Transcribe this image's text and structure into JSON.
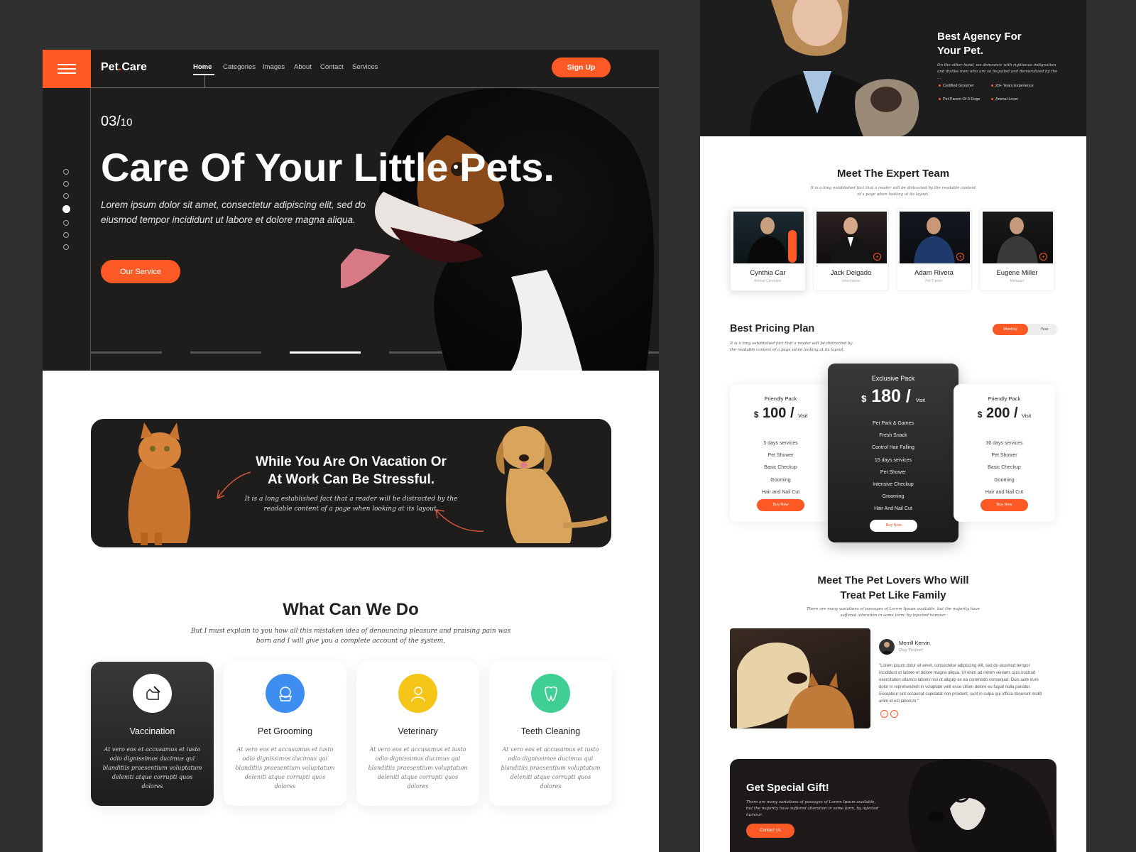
{
  "left": {
    "header": {
      "logo_main": "Pet",
      "logo_dot": ".",
      "logo_end": "Care",
      "nav": [
        "Home",
        "Categories",
        "Images",
        "About",
        "Contact",
        "Services"
      ],
      "signup": "Sign Up"
    },
    "hero": {
      "counter_current": "03/",
      "counter_total": "10",
      "title": "Care Of Your Little Pets.",
      "subtitle": "Lorem ipsum dolor sit amet, consectetur adipiscing elit, sed do eiusmod tempor incididunt ut labore et dolore magna aliqua.",
      "button": "Our Service",
      "active_slide_dot": 4,
      "active_slide_bar": 3
    },
    "vacation": {
      "title_line1": "While You Are On Vacation Or",
      "title_line2": "At Work Can Be Stressful.",
      "subtitle": "It is a long established fact that a reader will be distracted by the readable content of a page when looking at its layout."
    },
    "services": {
      "title": "What Can We Do",
      "subtitle": "But I must explain to you how all this mistaken idea of denouncing pleasure and praising pain was born and I will give you a complete account of the system,",
      "items": [
        {
          "name": "Vaccination",
          "desc": "At vero eos et accusamus et iusto odio dignissimos ducimus qui blanditiis praesentium voluptatum deleniti atque corrupti quos dolores",
          "icon": "vaccination-icon",
          "color": "#ffffff"
        },
        {
          "name": "Pet Grooming",
          "desc": "At vero eos et accusamus et iusto odio dignissimos ducimus qui blanditiis praesentium voluptatum deleniti atque corrupti quos dolores",
          "icon": "grooming-icon",
          "color": "#3d8ef0"
        },
        {
          "name": "Veterinary",
          "desc": "At vero eos et accusamus et iusto odio dignissimos ducimus qui blanditiis praesentium voluptatum deleniti atque corrupti quos dolores",
          "icon": "veterinary-icon",
          "color": "#f5c518"
        },
        {
          "name": "Teeth Cleaning",
          "desc": "At vero eos et accusamus et iusto odio dignissimos ducimus qui blanditiis praesentium voluptatum deleniti atque corrupti quos dolores",
          "icon": "teeth-icon",
          "color": "#3fcf95"
        }
      ]
    }
  },
  "right": {
    "agency": {
      "title_line1": "Best Agency For",
      "title_line2": "Your Pet.",
      "subtitle": "On the other hand, we denounce with righteous indignation and dislike men who are so beguiled and demoralized by the ...",
      "features": [
        "Certified Groomer",
        "20+ Years Experience",
        "Pet Parent Of 3 Dogs",
        "Animal Lover"
      ]
    },
    "team": {
      "title": "Meet The Expert Team",
      "subtitle": "It is a long established fact that a reader will be distracted by the readable content of a page when looking at its layout.",
      "members": [
        {
          "name": "Cynthia Car",
          "role": "Animal Caretaker"
        },
        {
          "name": "Jack Delgado",
          "role": "Veterinarian"
        },
        {
          "name": "Adam Rivera",
          "role": "Pet Trainer"
        },
        {
          "name": "Eugene Miller",
          "role": "Manager"
        }
      ]
    },
    "pricing": {
      "title": "Best Pricing Plan",
      "subtitle": "It is a long established fact that a reader will be distracted by the readable content of a page when looking at its layout.",
      "toggle_monthly": "Monthly",
      "toggle_year": "Year",
      "currency": "$",
      "per": "Visit",
      "slash": "/",
      "plans": [
        {
          "name": "Friendly Pack",
          "price": "100",
          "features": [
            "5 days services",
            "Pet Shower",
            "Basic Checkup",
            "Gooming",
            "Hair and Nail Cut"
          ],
          "button": "Buy Now"
        },
        {
          "name": "Exclusive Pack",
          "price": "180",
          "features": [
            "Pet Park & Games",
            "Fresh Snack",
            "Control Hair Falling",
            "15 days services",
            "Pet Shower",
            "Intensive Checkup",
            "Grooming",
            "Hair And Nail Cut"
          ],
          "button": "Buy Now"
        },
        {
          "name": "Friendly Pack",
          "price": "200",
          "features": [
            "30 days services",
            "Pet Shower",
            "Basic Checkup",
            "Gooming",
            "Hair and Nail Cut"
          ],
          "button": "Buy Now"
        }
      ]
    },
    "lovers": {
      "title_line1": "Meet The Pet Lovers Who Will",
      "title_line2": "Treat Pet Like Family",
      "subtitle": "There are many variations of passages of Lorem Ipsum available, but the majority have suffered alteration in some form, by injected humour.",
      "name": "Merrill Kervin",
      "role": "Dog Trainer",
      "quote": "\"Lorem ipsum dolor sit amet, consectetur adipiscing elit, sed do eiusmod tempor incididunt ut labore et dolore magna aliqua. Ut enim ad minim veniam, quis nostrud exercitation ullamco laboris nisi ut aliquip ex ea commodo consequat. Duis aute irure dolor in reprehenderit in voluptate velit esse cillum dolore eu fugiat nulla pariatur. Excepteur sint occaecat cupidatat non proident, sunt in culpa qui officia deserunt mollit anim id est laborum.\"",
      "prev": "←",
      "next": "→"
    },
    "gift": {
      "title": "Get Special Gift!",
      "subtitle": "There are many variations of passages of Lorem Ipsum available, but the majority have suffered alteration in some form, by injected humour.",
      "button": "Contact Us"
    }
  },
  "colors": {
    "accent": "#ff5a26",
    "dark": "#1f1c1c",
    "background": "#303031"
  }
}
